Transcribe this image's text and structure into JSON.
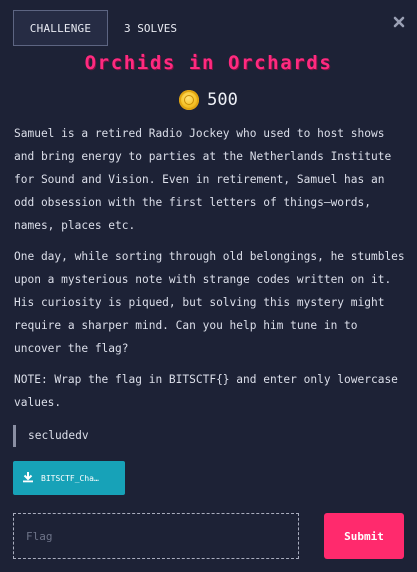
{
  "tabs": {
    "challenge_label": "CHALLENGE",
    "solves_label": "3 SOLVES"
  },
  "challenge": {
    "title": "Orchids in Orchards",
    "points": "500",
    "description": [
      "Samuel is a retired Radio Jockey who used to host shows and bring energy to parties at the Netherlands Institute for Sound and Vision. Even in retirement, Samuel has an odd obsession with the first letters of things—words, names, places etc.",
      "One day, while sorting through old belongings, he stumbles upon a mysterious note with strange codes written on it. His curiosity is piqued, but solving this mystery might require a sharper mind. Can you help him tune in to uncover the flag?",
      "NOTE: Wrap the flag in BITSCTF{} and enter only lowercase values."
    ],
    "author_hint": "secludedv",
    "file_label": "BITSCTF_Cha…"
  },
  "form": {
    "flag_placeholder": "Flag",
    "submit_label": "Submit"
  },
  "colors": {
    "background": "#1d2236",
    "title": "#ff2a7f",
    "file_button": "#17a2b8",
    "submit_button": "#ff2a6d"
  },
  "icons": {
    "close": "close-icon",
    "coin": "coin-icon",
    "download": "download-icon"
  }
}
